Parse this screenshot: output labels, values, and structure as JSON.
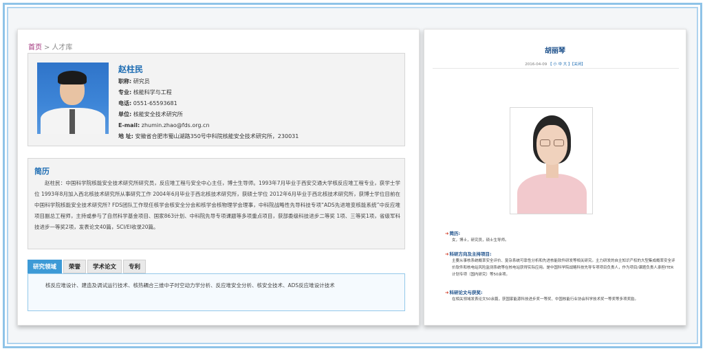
{
  "left": {
    "breadcrumb": {
      "home": "首页",
      "separator": ">",
      "current": "人才库"
    },
    "profile": {
      "name": "赵柱民",
      "rows": [
        {
          "key": "职称:",
          "value": "研究员"
        },
        {
          "key": "专业:",
          "value": "核能科学与工程"
        },
        {
          "key": "电话:",
          "value": "0551-65593681"
        },
        {
          "key": "单位:",
          "value": "核能安全技术研究所"
        },
        {
          "key": "E-mail:",
          "value": "zhumin.zhao@fds.org.cn"
        },
        {
          "key": "地 址:",
          "value": "安徽省合肥市蜀山湖路350号中科院核能安全技术研究所，230031"
        }
      ]
    },
    "bio": {
      "title": "简历",
      "text": "赵柱民：中国科学院核能安全技术研究所研究员，反应堆工程与安全中心主任，博士生导师。1993年7月毕业于西安交通大学核反应堆工程专业，获学士学位 1993年8月加入西北核技术研究所从事研究工作 2004年6月毕业于西北核技术研究所，获硕士学位 2012年6月毕业于西北核技术研究所，获博士学位目前在中国科学院核能安全技术研究所? FDS团队工作现任核学会核安全分会和核学会核物理学会理事，中科院战略性先导科技专项“ADS先进堆变核能系统”中反应堆项目副总工程师，主持或参与了自然科学基金项目、国家863计划、中科院先导专项课题等多项重点项目，获部委级科技进步二等奖 1项、三等奖1项，省级军科技进步一等奖2项，发表论文40篇，SCI/EI收录20篇。"
    },
    "tabs": [
      {
        "label": "研究领域"
      },
      {
        "label": "荣誉"
      },
      {
        "label": "学术论文"
      },
      {
        "label": "专利"
      }
    ],
    "tab_content": "核反应堆设计、建造及调试运行技术、核热耦合三维中子时空动力学分析、反应堆安全分析、核安全技术、ADS反应堆设计技术"
  },
  "right": {
    "title": "胡丽琴",
    "meta": {
      "date": "2016-04-09",
      "size_label": "【 小 中 大 】",
      "close_label": "【关闭】"
    },
    "sections": [
      {
        "heading": "简历:",
        "body": "女，博士，研究员，硕士生导师。"
      },
      {
        "heading": "科研方向及主持项目:",
        "body": "主要从事核系统概率安全评价、复杂系统可靠性分析和先进核能软件研发等相关研究。主力研发的自主知识产权的大型集成概率安全评价软件和核电站风险监测系统等在核电站获得实际应用。是中国科学院战略科技先导专项项目负责人，作为项目/课题负责人承担ITER计划专项（国内研究）等50余项。"
      },
      {
        "heading": "科研论文与获奖:",
        "body": "在相关领域发表论文50余篇，获国家能源科技进步奖一等奖、中国核能行业协会科学技术奖一等奖等多项奖励。"
      }
    ]
  },
  "colors": {
    "accent": "#1b6bb2",
    "tab_active": "#3d9ad6",
    "frame": "#8ec3e8",
    "breadcrumb_home": "#a0307a"
  },
  "icons": {
    "section_marker": "arrow-icon"
  }
}
